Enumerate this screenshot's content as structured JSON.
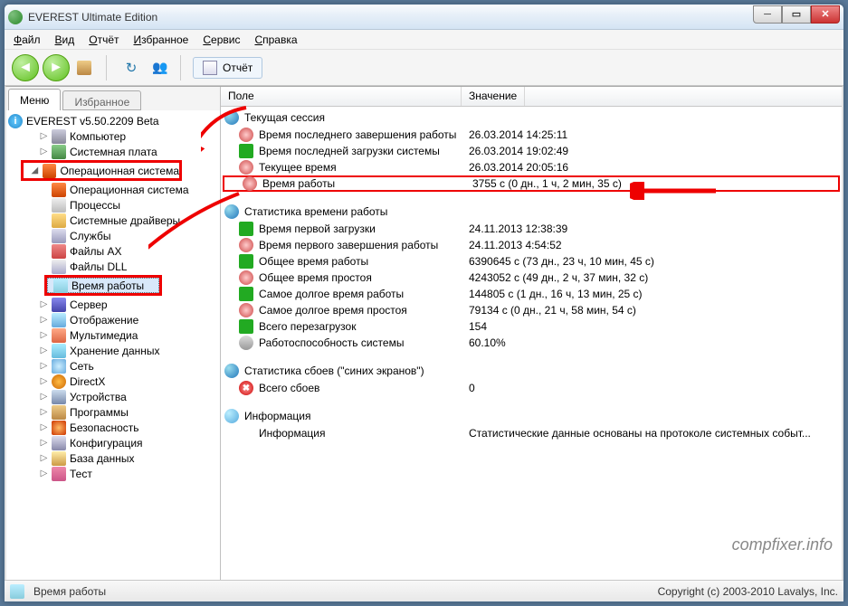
{
  "window": {
    "title": "EVEREST Ultimate Edition"
  },
  "menu": {
    "file": "Файл",
    "view": "Вид",
    "report": "Отчёт",
    "fav": "Избранное",
    "service": "Сервис",
    "help": "Справка"
  },
  "toolbar": {
    "report_label": "Отчёт"
  },
  "tabs": {
    "menu": "Меню",
    "fav": "Избранное"
  },
  "tree": {
    "root": "EVEREST v5.50.2209 Beta",
    "computer": "Компьютер",
    "board": "Системная плата",
    "os": "Операционная система",
    "os_children": {
      "os2": "Операционная система",
      "proc": "Процессы",
      "drv": "Системные драйверы",
      "svc": "Службы",
      "ax": "Файлы AX",
      "dll": "Файлы DLL",
      "uptime": "Время работы"
    },
    "server": "Сервер",
    "display": "Отображение",
    "mm": "Мультимедиа",
    "storage": "Хранение данных",
    "net": "Сеть",
    "dx": "DirectX",
    "dev": "Устройства",
    "prog": "Программы",
    "sec": "Безопасность",
    "cfg": "Конфигурация",
    "db": "База данных",
    "test": "Тест"
  },
  "columns": {
    "field": "Поле",
    "value": "Значение"
  },
  "sections": {
    "session": {
      "title": "Текущая сессия",
      "rows": [
        {
          "f": "Время последнего завершения работы",
          "v": "26.03.2014 14:25:11",
          "ic": "ri-time"
        },
        {
          "f": "Время последней загрузки системы",
          "v": "26.03.2014 19:02:49",
          "ic": "ri-green"
        },
        {
          "f": "Текущее время",
          "v": "26.03.2014 20:05:16",
          "ic": "ri-time"
        },
        {
          "f": "Время работы",
          "v": "3755 с (0 дн., 1 ч, 2 мин, 35 с)",
          "ic": "ri-time",
          "hl": true
        }
      ]
    },
    "stats": {
      "title": "Статистика времени работы",
      "rows": [
        {
          "f": "Время первой загрузки",
          "v": "24.11.2013 12:38:39",
          "ic": "ri-green"
        },
        {
          "f": "Время первого завершения работы",
          "v": "24.11.2013 4:54:52",
          "ic": "ri-time"
        },
        {
          "f": "Общее время работы",
          "v": "6390645 c (73 дн., 23 ч, 10 мин, 45 с)",
          "ic": "ri-green"
        },
        {
          "f": "Общее время простоя",
          "v": "4243052 c (49 дн., 2 ч, 37 мин, 32 с)",
          "ic": "ri-time"
        },
        {
          "f": "Самое долгое время работы",
          "v": "144805 c (1 дн., 16 ч, 13 мин, 25 с)",
          "ic": "ri-green"
        },
        {
          "f": "Самое долгое время простоя",
          "v": "79134 c (0 дн., 21 ч, 58 мин, 54 с)",
          "ic": "ri-time"
        },
        {
          "f": "Всего перезагрузок",
          "v": "154",
          "ic": "ri-green"
        },
        {
          "f": "Работоспособность системы",
          "v": "60.10%",
          "ic": "ri-gear"
        }
      ]
    },
    "failures": {
      "title": "Статистика сбоев (\"синих экранов\")",
      "rows": [
        {
          "f": "Всего сбоев",
          "v": "0",
          "ic": "ri-red"
        }
      ]
    },
    "info": {
      "title": "Информация",
      "rows": [
        {
          "f": "Информация",
          "v": "Статистические данные основаны на протоколе системных событ...",
          "ic": ""
        }
      ]
    }
  },
  "statusbar": {
    "left": "Время работы",
    "right": "Copyright (c) 2003-2010 Lavalys, Inc."
  },
  "watermark": "compfixer.info"
}
